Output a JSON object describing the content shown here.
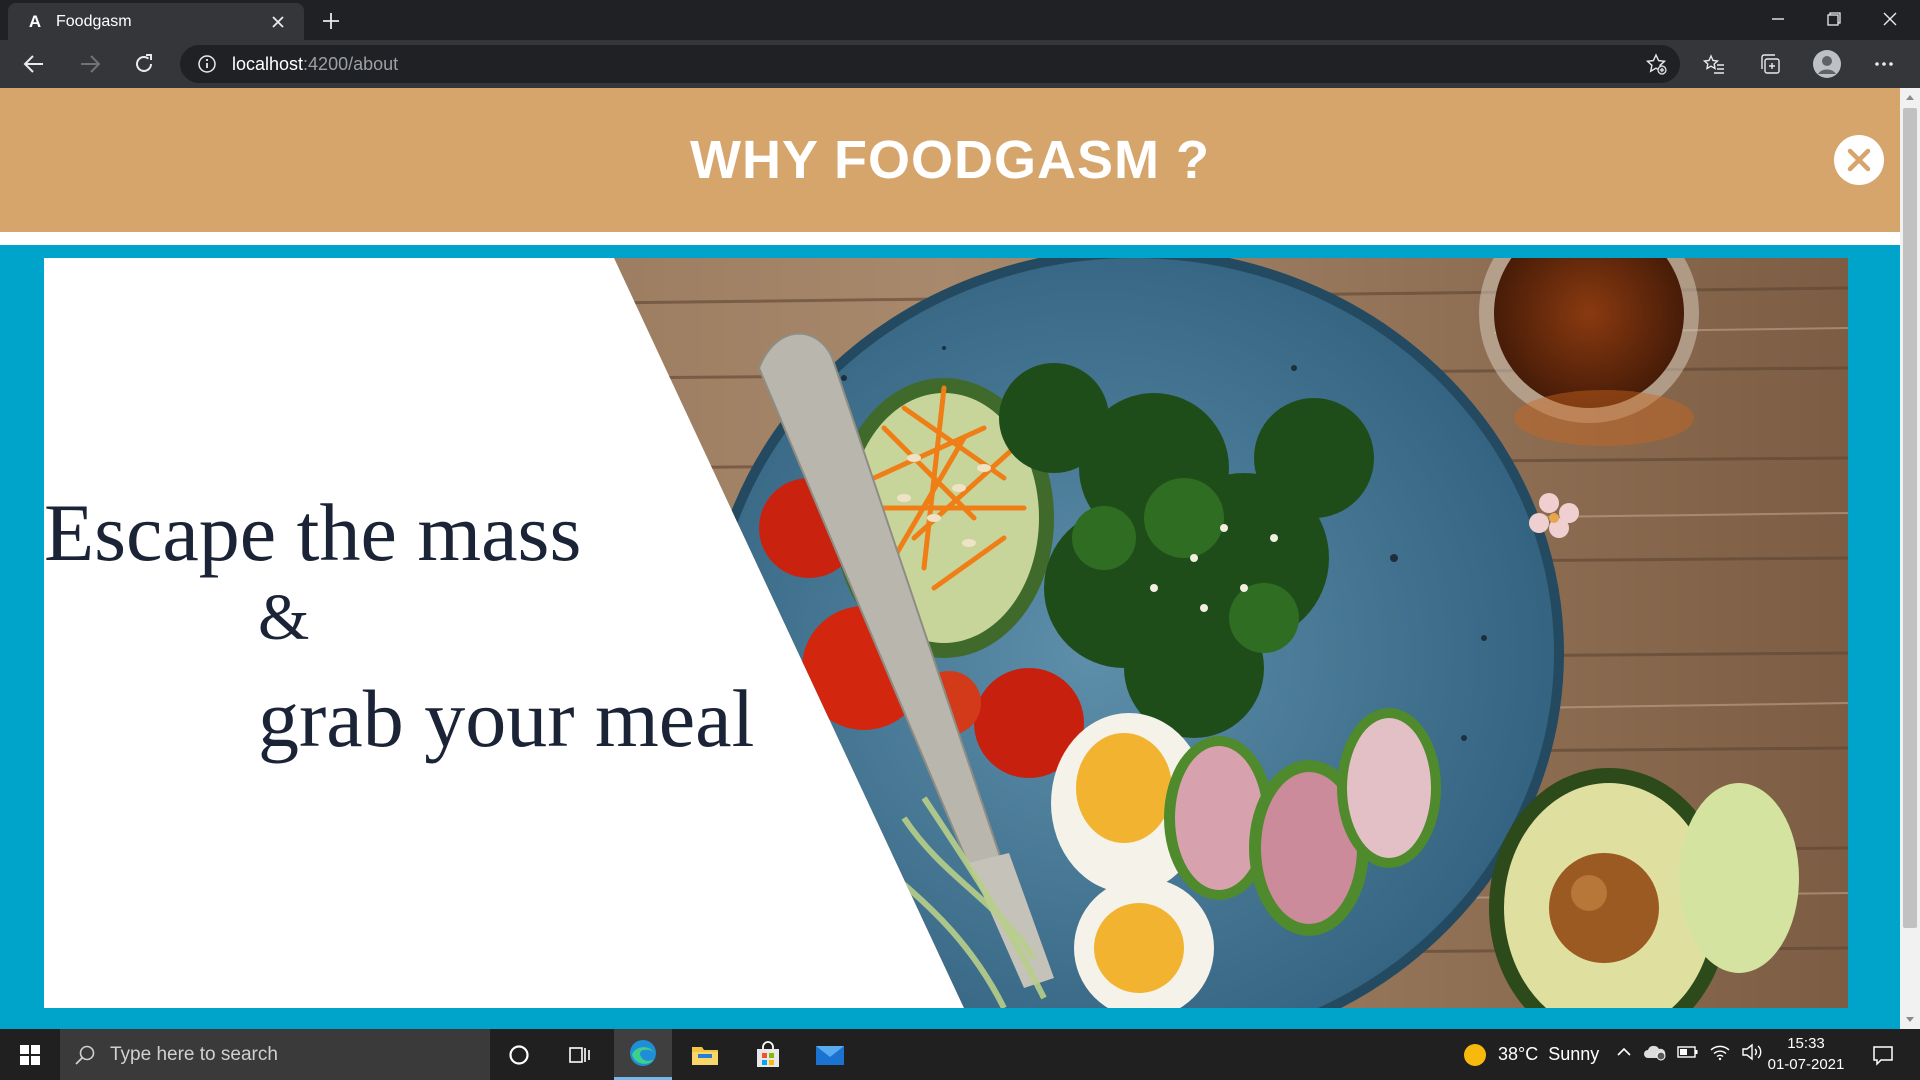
{
  "browser": {
    "tab": {
      "title": "Foodgasm",
      "favicon": "angular-icon"
    },
    "address": {
      "host": "localhost",
      "rest": ":4200/about"
    },
    "window_controls": [
      "minimize",
      "restore",
      "close"
    ]
  },
  "page": {
    "header": {
      "title": "WHY FOODGASM ?"
    },
    "hero": {
      "line1": "Escape the mass",
      "line2": "&",
      "line3": "grab your meal"
    },
    "colors": {
      "header_bg": "#d6a56b",
      "frame_bg": "#00a3c9",
      "text": "#1b2436"
    }
  },
  "taskbar": {
    "search_placeholder": "Type here to search",
    "apps": [
      "cortana-icon",
      "task-view-icon",
      "edge-icon",
      "file-explorer-icon",
      "store-icon",
      "mail-icon"
    ],
    "weather": {
      "temp": "38°C",
      "condition": "Sunny"
    },
    "clock": {
      "time": "15:33",
      "date": "01-07-2021"
    }
  }
}
